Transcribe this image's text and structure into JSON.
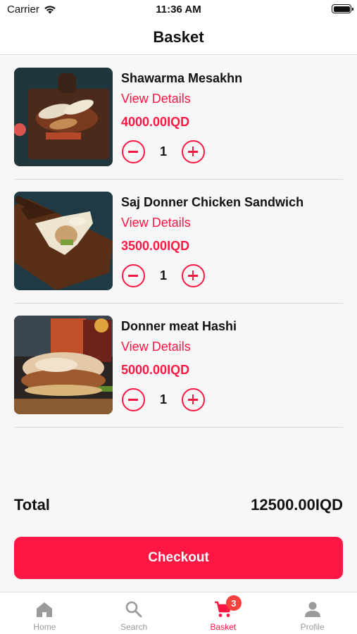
{
  "status_bar": {
    "carrier": "Carrier",
    "time": "11:36 AM"
  },
  "header": {
    "title": "Basket"
  },
  "items": [
    {
      "name": "Shawarma Mesakhn",
      "details_label": "View Details",
      "price": "4000.00IQD",
      "quantity": "1",
      "image": "shawarma-mesakhn-photo"
    },
    {
      "name": "Saj Donner Chicken Sandwich",
      "details_label": "View Details",
      "price": "3500.00IQD",
      "quantity": "1",
      "image": "saj-donner-chicken-photo"
    },
    {
      "name": "Donner meat Hashi",
      "details_label": "View Details",
      "price": "5000.00IQD",
      "quantity": "1",
      "image": "donner-meat-hashi-photo"
    }
  ],
  "summary": {
    "total_label": "Total",
    "total_value": "12500.00IQD"
  },
  "checkout": {
    "label": "Checkout"
  },
  "tab_bar": {
    "tabs": [
      {
        "label": "Home",
        "icon": "home-icon"
      },
      {
        "label": "Search",
        "icon": "search-icon"
      },
      {
        "label": "Basket",
        "icon": "cart-icon",
        "badge": "3",
        "active": true
      },
      {
        "label": "Profile",
        "icon": "person-icon"
      }
    ]
  },
  "colors": {
    "accent": "#ff1744",
    "badge": "#f4433c",
    "inactive_tab": "#9a9a9a"
  }
}
